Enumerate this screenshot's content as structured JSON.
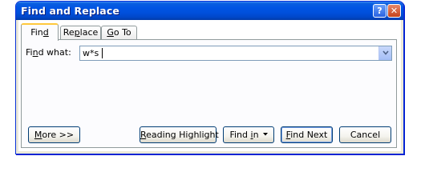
{
  "window": {
    "title": "Find and Replace",
    "help_icon": "help-icon",
    "close_icon": "close-icon"
  },
  "tabs": [
    {
      "label_before": "Fin",
      "label_underlined": "d",
      "label_after": "",
      "active": true
    },
    {
      "label_before": "Re",
      "label_underlined": "p",
      "label_after": "lace",
      "active": false
    },
    {
      "label_before": "",
      "label_underlined": "G",
      "label_after": "o To",
      "active": false
    }
  ],
  "find": {
    "label_before": "Fi",
    "label_underlined": "n",
    "label_after": "d what:",
    "value": "w*s"
  },
  "buttons": {
    "more_before": "",
    "more_underlined": "M",
    "more_after": "ore >>",
    "reading_before": "",
    "reading_underlined": "R",
    "reading_after": "eading Highlight",
    "findin_before": "Find ",
    "findin_underlined": "i",
    "findin_after": "n",
    "findnext_before": "",
    "findnext_underlined": "F",
    "findnext_after": "ind Next",
    "cancel": "Cancel"
  },
  "colors": {
    "titlebar": "#0054e3",
    "dialog_face": "#ece9d8",
    "active_tab_accent": "#ffc83c"
  }
}
